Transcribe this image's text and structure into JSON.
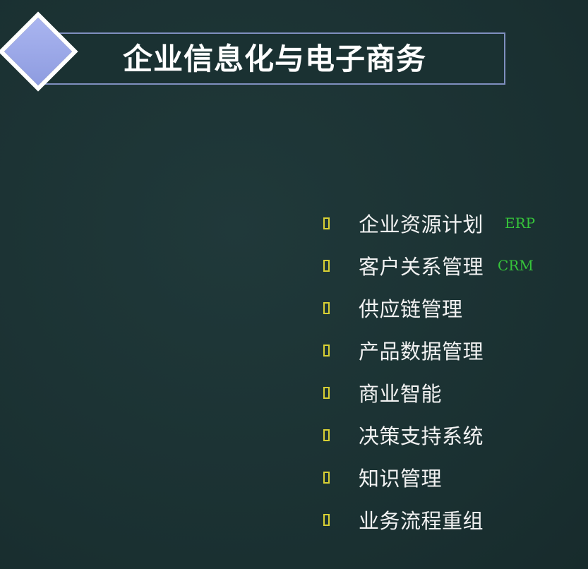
{
  "slide": {
    "title": "企业信息化与电子商务",
    "items": [
      {
        "label": "企业资源计划",
        "tag": "ERP"
      },
      {
        "label": "客户关系管理",
        "tag": "CRM"
      },
      {
        "label": "供应链管理"
      },
      {
        "label": "产品数据管理"
      },
      {
        "label": "商业智能"
      },
      {
        "label": "决策支持系统"
      },
      {
        "label": "知识管理"
      },
      {
        "label": "业务流程重组"
      }
    ]
  },
  "colors": {
    "background": "#1b3233",
    "title_border": "#7f8fbf",
    "diamond_fill": "#9aa6e8",
    "bullet": "#d8d034",
    "tag": "#36c43a",
    "text": "#f2f2f2"
  },
  "icons": {
    "title_marker": "diamond-icon",
    "bullet": "hollow-rectangle-bullet-icon"
  }
}
